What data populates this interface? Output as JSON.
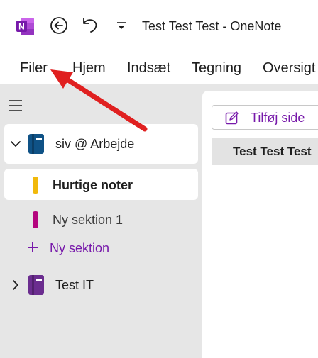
{
  "titlebar": {
    "doc_title": "Test Test Test  -  OneNote",
    "app_icon": "onenote-logo-icon",
    "back_icon": "back-arrow-icon",
    "undo_icon": "undo-icon",
    "qat_icon": "customize-quick-access-icon"
  },
  "ribbon": {
    "tabs": [
      "Filer",
      "Hjem",
      "Indsæt",
      "Tegning",
      "Oversigt"
    ]
  },
  "sidebar": {
    "toggle_icon": "hamburger-menu-icon",
    "notebooks": [
      {
        "label": "siv @ Arbejde",
        "expanded": true,
        "color": "#0f5286"
      },
      {
        "label": "Test IT",
        "expanded": false,
        "color": "#6b2d8f"
      }
    ],
    "sections": [
      {
        "label": "Hurtige noter",
        "color": "#f1b90b",
        "selected": true
      },
      {
        "label": "Ny sektion 1",
        "color": "#b4057e",
        "selected": false
      }
    ],
    "add_section_label": "Ny sektion"
  },
  "pages": {
    "add_page_label": "Tilføj side",
    "items": [
      {
        "label": "Test Test Test"
      }
    ]
  },
  "colors": {
    "accent": "#7719aa",
    "annotation_arrow": "#e02020"
  }
}
